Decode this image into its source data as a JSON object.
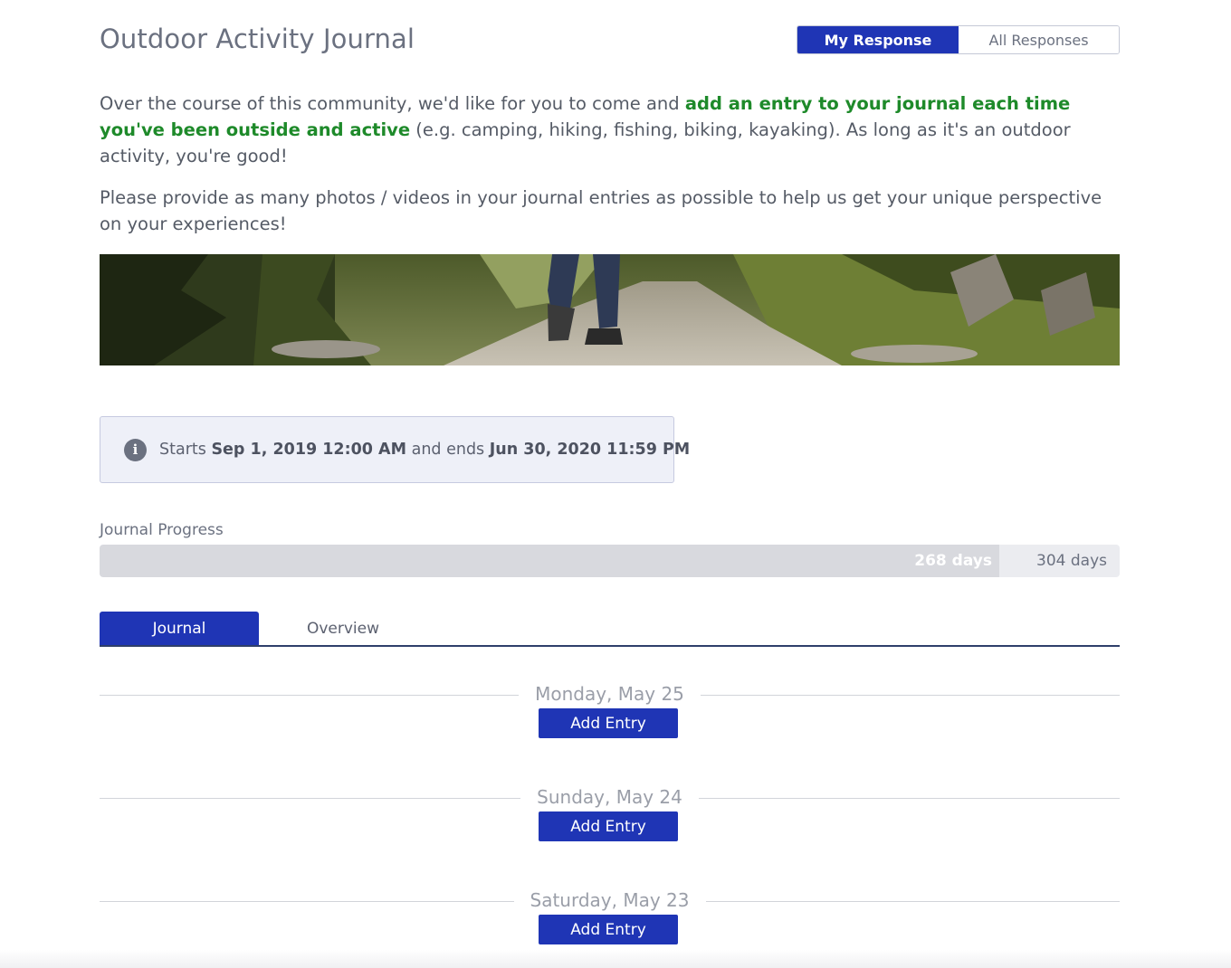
{
  "header": {
    "title": "Outdoor Activity Journal",
    "toggle": {
      "active_label": "My Response",
      "inactive_label": "All Responses"
    }
  },
  "intro": {
    "p1_before": "Over the course of this community, we'd like for you to come and ",
    "p1_highlight": "add an entry to your journal each time you've been outside and active",
    "p1_after": " (e.g. camping, hiking, fishing, biking, kayaking). As long as it's an outdoor activity, you're good!",
    "p2": "Please provide as many photos / videos in your journal entries as possible to help us get your unique perspective on your experiences!"
  },
  "banner": {
    "icon": "hiking-trail-photo"
  },
  "schedule": {
    "icon": "info-icon",
    "starts_label": "Starts",
    "start": "Sep 1, 2019 12:00 AM",
    "ends_label": "and ends",
    "end": "Jun 30, 2020 11:59 PM"
  },
  "progress": {
    "label": "Journal Progress",
    "elapsed_label": "268 days",
    "total_label": "304 days",
    "elapsed_days": 268,
    "total_days": 304
  },
  "tabs": [
    {
      "label": "Journal",
      "active": true
    },
    {
      "label": "Overview",
      "active": false
    }
  ],
  "days": [
    {
      "label": "Monday, May 25",
      "button": "Add Entry"
    },
    {
      "label": "Sunday, May 24",
      "button": "Add Entry"
    },
    {
      "label": "Saturday, May 23",
      "button": "Add Entry"
    }
  ],
  "colors": {
    "accent": "#1f35b5",
    "highlight_green": "#1e8a2a"
  }
}
